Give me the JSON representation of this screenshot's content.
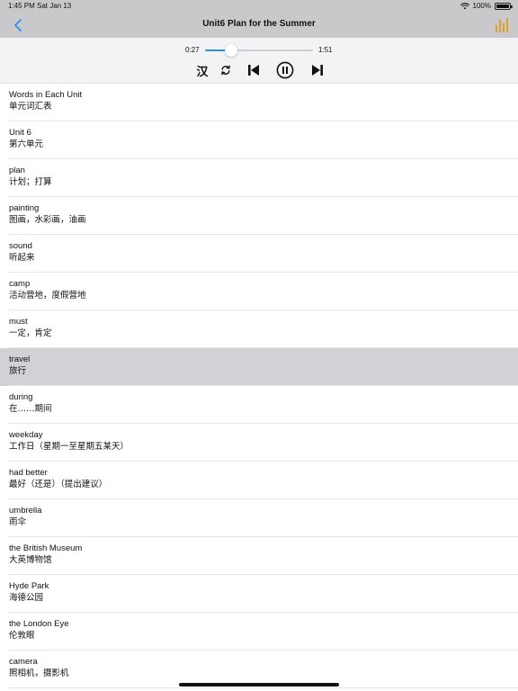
{
  "status_bar": {
    "time": "1:45 PM",
    "date": "Sat Jan 13",
    "battery_percent": "100%"
  },
  "nav": {
    "title": "Unit6 Plan for the Summer",
    "back_icon": "chevron-left-icon",
    "right_icon": "levels-icon",
    "accent_color": "#2f8ee8",
    "levels_color": "#e0a12c"
  },
  "player": {
    "current_time": "0:27",
    "total_time": "1:51",
    "progress_fraction": 0.243,
    "chinese_toggle_label": "汉",
    "repeat_icon": "repeat-icon",
    "prev_icon": "skip-previous-icon",
    "pause_icon": "pause-icon",
    "next_icon": "skip-next-icon"
  },
  "words": [
    {
      "en": "Words in Each Unit",
      "zh": "单元词汇表",
      "selected": false
    },
    {
      "en": "Unit 6",
      "zh": "第六单元",
      "selected": false
    },
    {
      "en": "plan",
      "zh": "计划；打算",
      "selected": false
    },
    {
      "en": "painting",
      "zh": "图画，水彩画，油画",
      "selected": false
    },
    {
      "en": "sound",
      "zh": "听起来",
      "selected": false
    },
    {
      "en": "camp",
      "zh": "活动营地，度假营地",
      "selected": false
    },
    {
      "en": "must",
      "zh": "一定，肯定",
      "selected": false
    },
    {
      "en": "travel",
      "zh": "旅行",
      "selected": true
    },
    {
      "en": "during",
      "zh": "在……期间",
      "selected": false
    },
    {
      "en": "weekday",
      "zh": "工作日（星期一至星期五某天）",
      "selected": false
    },
    {
      "en": "had better",
      "zh": "最好（还是）（提出建议）",
      "selected": false
    },
    {
      "en": "umbrella",
      "zh": "雨伞",
      "selected": false
    },
    {
      "en": "the British Museum",
      "zh": "大英博物馆",
      "selected": false
    },
    {
      "en": "Hyde Park",
      "zh": "海德公园",
      "selected": false
    },
    {
      "en": "the London Eye",
      "zh": "伦敦眼",
      "selected": false
    },
    {
      "en": "camera",
      "zh": "照相机，摄影机",
      "selected": false
    }
  ]
}
